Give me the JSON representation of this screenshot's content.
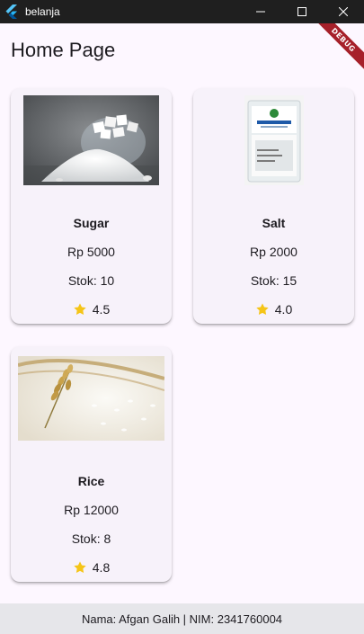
{
  "window": {
    "title": "belanja",
    "icon": "flutter-logo-icon",
    "controls": [
      "minimize-icon",
      "maximize-icon",
      "close-icon"
    ]
  },
  "debug_banner": {
    "label": "DEBUG",
    "color": "#a6202a"
  },
  "app_bar": {
    "title": "Home Page"
  },
  "products": [
    {
      "name": "Sugar",
      "price": "Rp 5000",
      "stock": "Stok: 10",
      "rating": "4.5",
      "image": "sugar-image"
    },
    {
      "name": "Salt",
      "price": "Rp 2000",
      "stock": "Stok: 15",
      "rating": "4.0",
      "image": "salt-package-image"
    },
    {
      "name": "Rice",
      "price": "Rp 12000",
      "stock": "Stok: 8",
      "rating": "4.8",
      "image": "rice-image"
    }
  ],
  "rating_icon": "star-icon",
  "colors": {
    "star": "#f5c518",
    "card_bg": "#f7f2fa",
    "page_bg": "#fdf7ff",
    "footer_bg": "#e6e6ea"
  },
  "footer": {
    "text": "Nama: Afgan Galih | NIM: 2341760004"
  }
}
